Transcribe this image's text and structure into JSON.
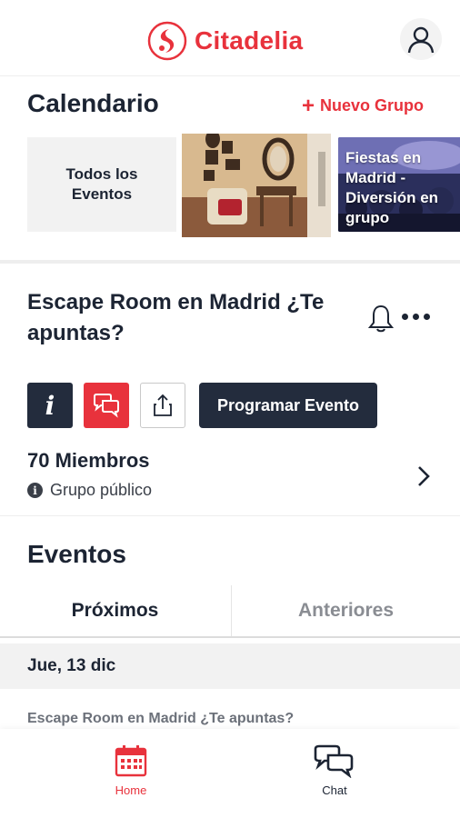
{
  "header": {
    "brand_name": "Citadelia",
    "logo_icon": "citadelia-logo-icon",
    "profile_icon": "user-icon"
  },
  "calendar": {
    "title": "Calendario",
    "new_group_plus": "+",
    "new_group_label": "Nuevo Grupo",
    "cards": [
      {
        "label": "Todos los Eventos"
      },
      {
        "label": ""
      },
      {
        "label": "Fiestas en Madrid - Diversión en grupo"
      }
    ]
  },
  "group": {
    "title": "Escape Room en Madrid ¿Te apuntas?",
    "bell_icon": "bell-icon",
    "more_icon": "more-horizontal-icon",
    "info_button": "i",
    "program_button": "Programar Evento",
    "members": "70 Miembros",
    "info_dot": "i",
    "type": "Grupo público"
  },
  "events": {
    "title": "Eventos",
    "tabs": [
      {
        "label": "Próximos"
      },
      {
        "label": "Anteriores"
      }
    ],
    "date": "Jue, 13 dic",
    "first_event": "Escape Room en Madrid ¿Te apuntas?"
  },
  "bottom_nav": {
    "items": [
      {
        "label": "Home"
      },
      {
        "label": "Chat"
      }
    ]
  },
  "colors": {
    "brand": "#e8323c",
    "dark": "#232c3d",
    "muted": "#8a8d93"
  }
}
